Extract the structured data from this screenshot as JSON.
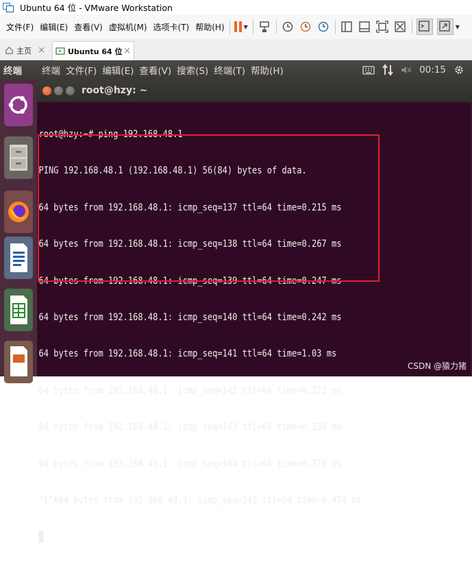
{
  "window": {
    "title": "Ubuntu 64 位 - VMware Workstation"
  },
  "vmware_menu": [
    "文件(F)",
    "编辑(E)",
    "查看(V)",
    "虚拟机(M)",
    "选项卡(T)",
    "帮助(H)"
  ],
  "tabs": [
    {
      "label": "主页"
    },
    {
      "label": "Ubuntu 64 位"
    }
  ],
  "ubuntu_panel": {
    "app_name": "终端",
    "menus": [
      "终端",
      "文件(F)",
      "编辑(E)",
      "查看(V)",
      "搜索(S)",
      "终端(T)",
      "帮助(H)"
    ],
    "clock": "00:15"
  },
  "terminal": {
    "title": "root@hzy: ~",
    "lines": [
      "root@hzy:~# ping 192.168.48.1",
      "PING 192.168.48.1 (192.168.48.1) 56(84) bytes of data.",
      "64 bytes from 192.168.48.1: icmp_seq=137 ttl=64 time=0.215 ms",
      "64 bytes from 192.168.48.1: icmp_seq=138 ttl=64 time=0.267 ms",
      "64 bytes from 192.168.48.1: icmp_seq=139 ttl=64 time=0.247 ms",
      "64 bytes from 192.168.48.1: icmp_seq=140 ttl=64 time=0.242 ms",
      "64 bytes from 192.168.48.1: icmp_seq=141 ttl=64 time=1.03 ms",
      "64 bytes from 192.168.48.1: icmp_seq=142 ttl=64 time=0.222 ms",
      "64 bytes from 192.168.48.1: icmp_seq=143 ttl=64 time=0.238 ms",
      "64 bytes from 192.168.48.1: icmp_seq=144 ttl=64 time=0.778 ms",
      "^[^A64 bytes from 192.168.48.1: icmp_seq=145 ttl=64 time=0.474 ms"
    ]
  },
  "watermark": "CSDN @猿力猪",
  "colors": {
    "terminal_bg": "#300a24",
    "highlight_border": "#e0202a",
    "pause_orange": "#f2622b"
  }
}
